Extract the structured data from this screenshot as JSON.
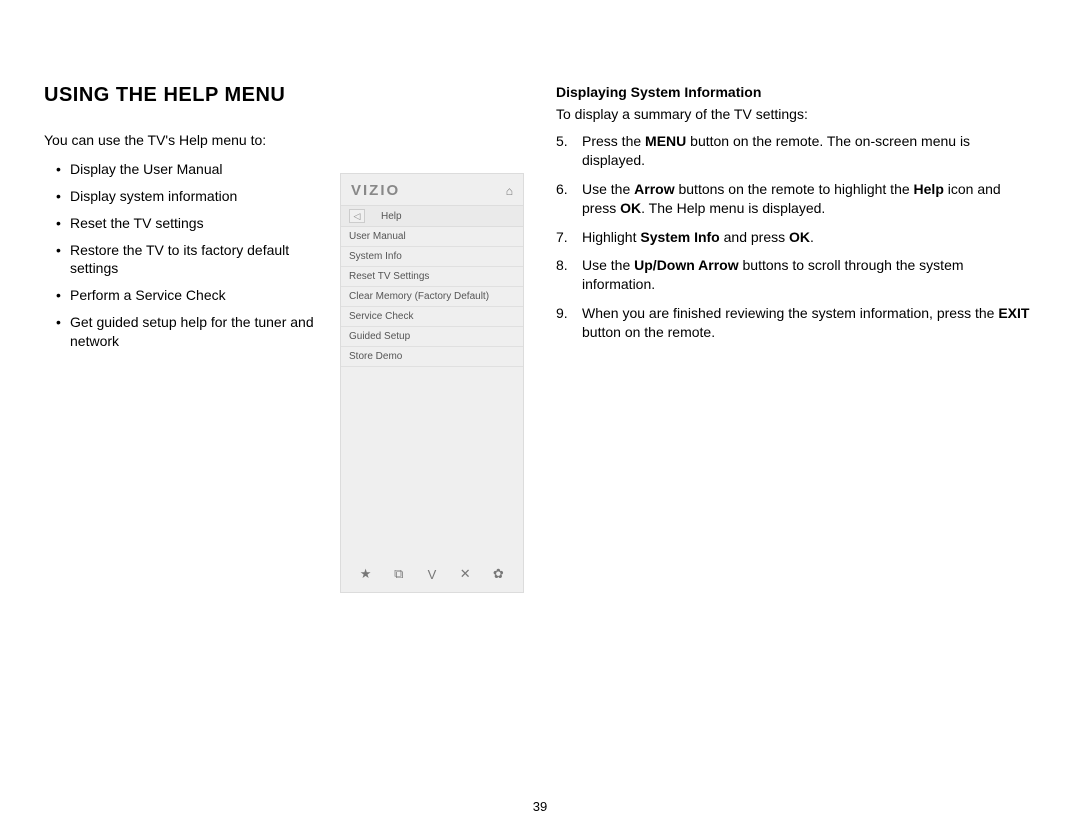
{
  "page_number": "39",
  "left": {
    "title": "USING THE HELP MENU",
    "intro": "You can use the TV's Help menu to:",
    "bullets": [
      "Display the User Manual",
      "Display system information",
      "Reset the TV settings",
      "Restore the TV to its factory default settings",
      "Perform a Service Check",
      "Get guided setup help for the tuner and network"
    ]
  },
  "tv": {
    "brand": "VIZIO",
    "crumb_label": "Help",
    "menu_items": [
      "User Manual",
      "System Info",
      "Reset TV Settings",
      "Clear Memory (Factory Default)",
      "Service Check",
      "Guided Setup",
      "Store Demo"
    ],
    "footer_icons": [
      "★",
      "⧉",
      "V",
      "✕",
      "✿"
    ]
  },
  "right": {
    "subtitle": "Displaying System Information",
    "intro": "To display a summary of the TV settings:",
    "steps": [
      {
        "pre": "Press the ",
        "b1": "MENU",
        "post": " button on the remote. The on-screen menu is displayed."
      },
      {
        "pre": "Use the ",
        "b1": "Arrow",
        "mid": " buttons on the remote to highlight the ",
        "b2": "Help",
        "mid2": " icon and press ",
        "b3": "OK",
        "post": ". The Help menu is displayed."
      },
      {
        "pre": "Highlight ",
        "b1": "System Info",
        "mid": " and press ",
        "b2": "OK",
        "post": "."
      },
      {
        "pre": "Use the ",
        "b1": "Up/Down Arrow",
        "post": " buttons to scroll through the system information."
      },
      {
        "pre": "When you are finished reviewing the system information, press the ",
        "b1": "EXIT",
        "post": " button on the remote."
      }
    ]
  }
}
